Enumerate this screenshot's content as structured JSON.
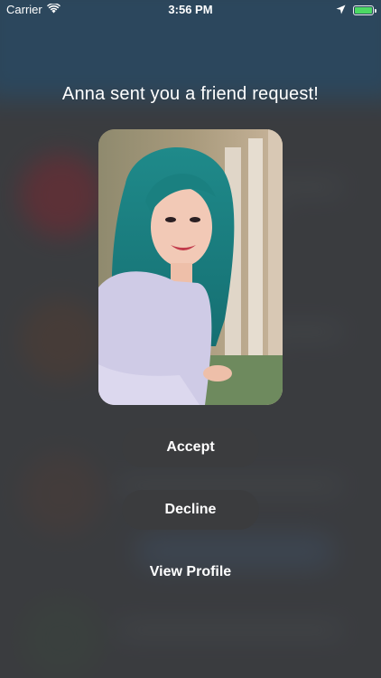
{
  "status_bar": {
    "carrier": "Carrier",
    "time": "3:56 PM",
    "battery_level": 1.0,
    "icons": [
      "wifi-icon",
      "location-arrow-icon",
      "battery-icon"
    ]
  },
  "friend_request": {
    "title": "Anna sent you a friend request!",
    "photo_subject": "profile-photo"
  },
  "actions": {
    "accept_label": "Accept",
    "decline_label": "Decline",
    "view_profile_label": "View Profile"
  },
  "colors": {
    "overlay": "#3f4144",
    "button": "#3b3c3e",
    "header_blur": "#1f5a86",
    "battery": "#4cd964"
  }
}
